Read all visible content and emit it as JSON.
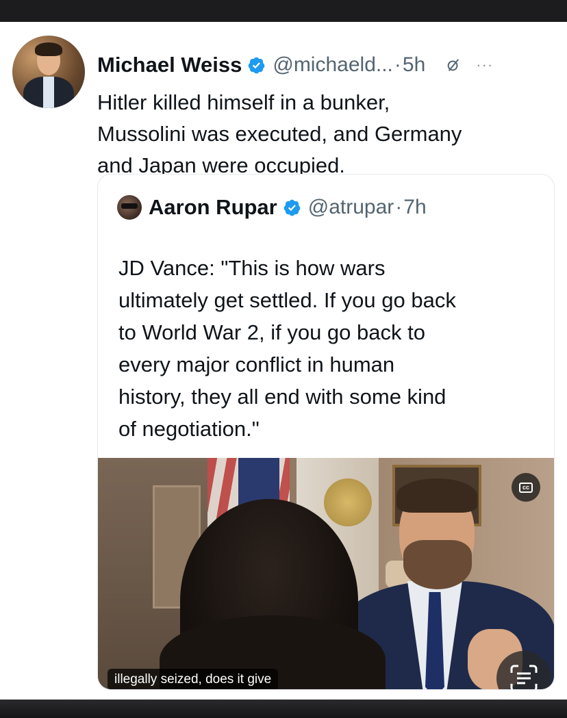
{
  "tweet": {
    "author_name": "Michael Weiss",
    "author_handle": "@michaeld...",
    "separator": "·",
    "time": "5h",
    "more_label": "···",
    "text_lines": [
      "Hitler killed himself in a bunker,",
      "Mussolini was executed, and Germany",
      "and Japan were occupied."
    ]
  },
  "quote": {
    "author_name": "Aaron Rupar",
    "author_handle": "@atrupar",
    "separator": "·",
    "time": "7h",
    "text_lines": [
      "JD Vance: \"This is how wars",
      "ultimately get settled. If you go back",
      "to World War 2, if you go back to",
      "every major conflict in human",
      "history, they all end with some kind",
      "of negotiation.\""
    ],
    "video": {
      "caption": "illegally seized, does it give",
      "cc_label": "cc"
    }
  },
  "colors": {
    "verified": "#1d9bf0",
    "secondary_text": "#536471",
    "frame": "#1c1c1e"
  }
}
